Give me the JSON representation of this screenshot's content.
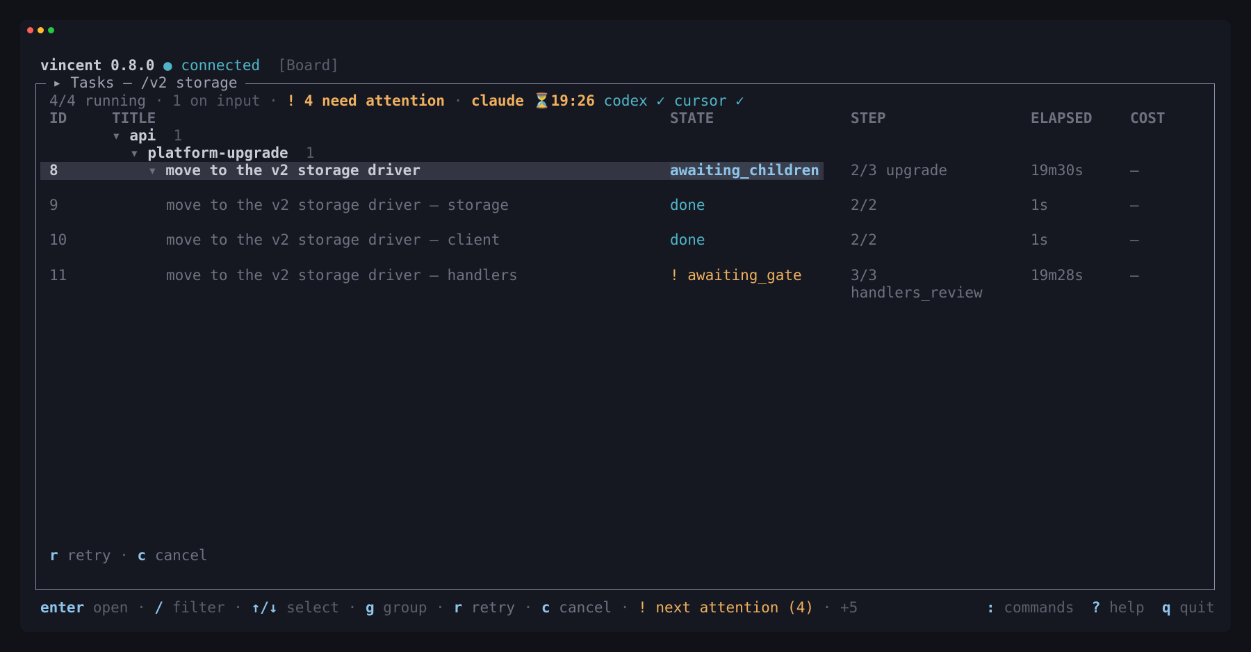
{
  "app": {
    "name": "vincent 0.8.0",
    "status_dot": "●",
    "status": "connected",
    "view": "[Board]"
  },
  "panel": {
    "title_prefix": "▸",
    "title": "Tasks — /v2 storage"
  },
  "summary": {
    "running": "4/4 running",
    "sep": "·",
    "on_input": "1 on input",
    "attention": "! 4 need attention",
    "agents": [
      {
        "name": "claude",
        "status_icon": "hourglass-icon",
        "status": "⏳19:26",
        "color": "#f0b05e"
      },
      {
        "name": "codex",
        "status_icon": "check-icon",
        "status": "✓",
        "color": "#4fb5c8"
      },
      {
        "name": "cursor",
        "status_icon": "check-icon",
        "status": "✓",
        "color": "#4fb5c8"
      }
    ]
  },
  "table": {
    "headers": {
      "id": "ID",
      "title": "TITLE",
      "state": "STATE",
      "step": "STEP",
      "elapsed": "ELAPSED",
      "cost": "COST"
    },
    "groups": [
      {
        "caret": "▾",
        "name": "api",
        "count": "1"
      },
      {
        "caret": "▾",
        "name": "platform-upgrade",
        "count": "1"
      }
    ],
    "rows": [
      {
        "id": "8",
        "caret": "▾",
        "title": "move to the v2 storage driver",
        "state": "awaiting_children",
        "step": "2/3 upgrade",
        "step2": "",
        "elapsed": "19m30s",
        "cost": "—",
        "selected": true
      },
      {
        "id": "9",
        "caret": "",
        "title": "move to the v2 storage driver — storage",
        "state": "done",
        "step": "2/2",
        "step2": "",
        "elapsed": "1s",
        "cost": "—"
      },
      {
        "id": "10",
        "caret": "",
        "title": "move to the v2 storage driver — client",
        "state": "done",
        "step": "2/2",
        "step2": "",
        "elapsed": "1s",
        "cost": "—"
      },
      {
        "id": "11",
        "caret": "",
        "title": "move to the v2 storage driver — handlers",
        "state": "! awaiting_gate",
        "step": "3/3",
        "step2": "handlers_review",
        "elapsed": "19m28s",
        "cost": "—"
      }
    ]
  },
  "panel_actions": [
    {
      "key": "r",
      "label": "retry"
    },
    {
      "key": "c",
      "label": "cancel"
    }
  ],
  "footer": {
    "left": [
      {
        "key": "enter",
        "label": "open"
      },
      {
        "key": "/",
        "label": "filter"
      },
      {
        "key": "↑/↓",
        "label": "select"
      },
      {
        "key": "g",
        "label": "group"
      },
      {
        "key": "r",
        "label": "retry"
      },
      {
        "key": "c",
        "label": "cancel"
      }
    ],
    "attention": "! next attention (4)",
    "more": "+5",
    "right": [
      {
        "key": ":",
        "label": "commands"
      },
      {
        "key": "?",
        "label": "help"
      },
      {
        "key": "q",
        "label": "quit"
      }
    ]
  },
  "colors": {
    "background": "#161821",
    "accent_cyan": "#4fb5c8",
    "accent_blue": "#8ec5ea",
    "warning_orange": "#f0b05e",
    "selection": "#333642"
  }
}
